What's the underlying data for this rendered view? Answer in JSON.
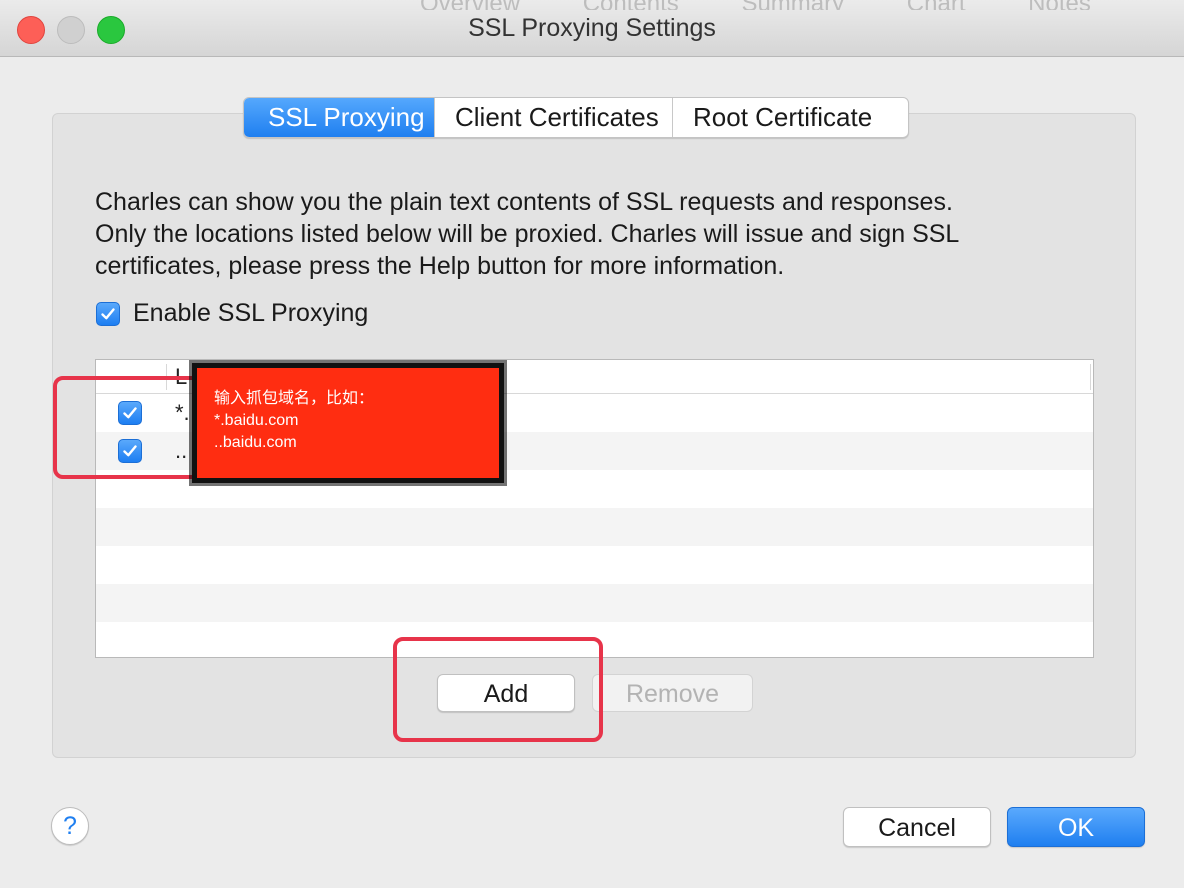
{
  "window": {
    "title": "SSL Proxying Settings",
    "background_tabs": [
      "Overview",
      "Contents",
      "Summary",
      "Chart",
      "Notes"
    ]
  },
  "tabs": [
    {
      "label": "SSL Proxying",
      "active": true
    },
    {
      "label": "Client Certificates",
      "active": false
    },
    {
      "label": "Root Certificate",
      "active": false
    }
  ],
  "description": {
    "line1": "Charles can show you the plain text contents of SSL requests and responses.",
    "line2": "Only the locations listed below will be proxied. Charles will issue and sign SSL",
    "line3": "certificates, please press the Help button for more information."
  },
  "enable_ssl": {
    "label": "Enable SSL Proxying",
    "checked": true
  },
  "table": {
    "header": "L",
    "rows": [
      {
        "checked": true,
        "text": "*."
      },
      {
        "checked": true,
        "text": ".."
      }
    ]
  },
  "annotation": {
    "line1": "输入抓包域名，比如：",
    "line2": "*.baidu.com",
    "line3": "..baidu.com"
  },
  "buttons": {
    "add": "Add",
    "remove": "Remove",
    "help": "?",
    "cancel": "Cancel",
    "ok": "OK"
  },
  "colors": {
    "accent": "#1f7ff0",
    "annotation_fill": "#ff2d11",
    "highlight_border": "#e7344a"
  }
}
